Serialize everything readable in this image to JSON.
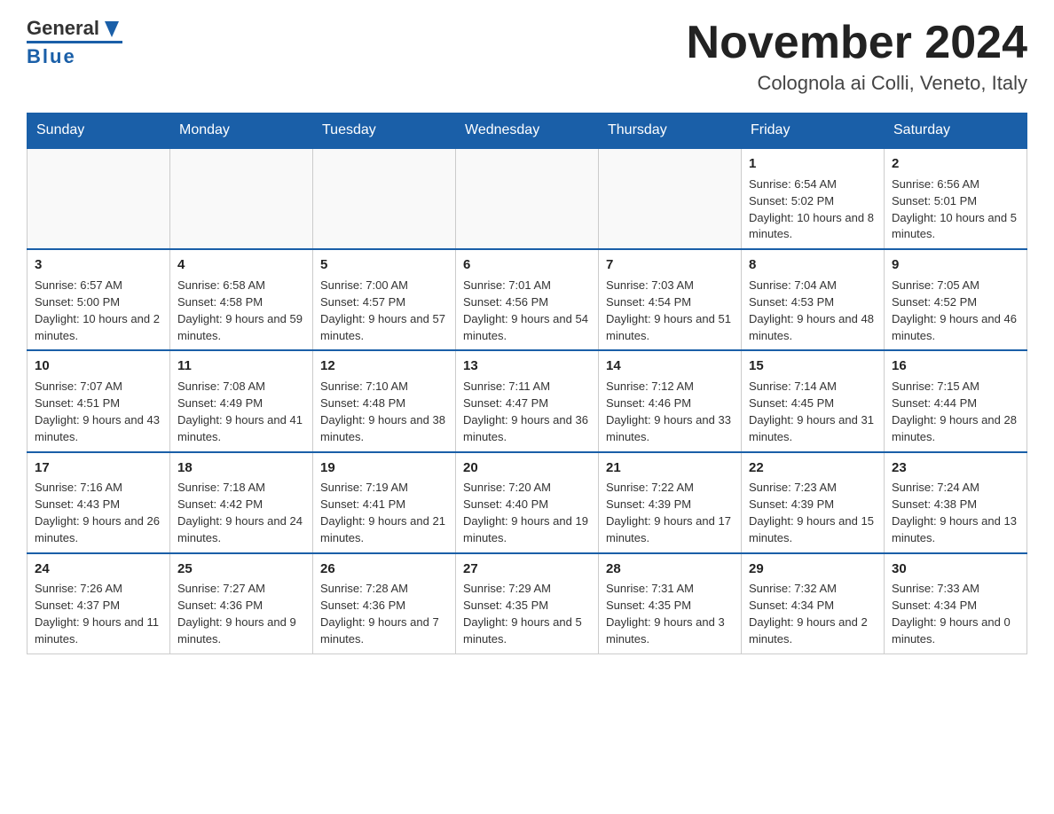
{
  "header": {
    "logo_general": "General",
    "logo_blue": "Blue",
    "month_title": "November 2024",
    "location": "Colognola ai Colli, Veneto, Italy"
  },
  "days_of_week": [
    "Sunday",
    "Monday",
    "Tuesday",
    "Wednesday",
    "Thursday",
    "Friday",
    "Saturday"
  ],
  "weeks": [
    [
      {
        "day": "",
        "info": ""
      },
      {
        "day": "",
        "info": ""
      },
      {
        "day": "",
        "info": ""
      },
      {
        "day": "",
        "info": ""
      },
      {
        "day": "",
        "info": ""
      },
      {
        "day": "1",
        "info": "Sunrise: 6:54 AM\nSunset: 5:02 PM\nDaylight: 10 hours and 8 minutes."
      },
      {
        "day": "2",
        "info": "Sunrise: 6:56 AM\nSunset: 5:01 PM\nDaylight: 10 hours and 5 minutes."
      }
    ],
    [
      {
        "day": "3",
        "info": "Sunrise: 6:57 AM\nSunset: 5:00 PM\nDaylight: 10 hours and 2 minutes."
      },
      {
        "day": "4",
        "info": "Sunrise: 6:58 AM\nSunset: 4:58 PM\nDaylight: 9 hours and 59 minutes."
      },
      {
        "day": "5",
        "info": "Sunrise: 7:00 AM\nSunset: 4:57 PM\nDaylight: 9 hours and 57 minutes."
      },
      {
        "day": "6",
        "info": "Sunrise: 7:01 AM\nSunset: 4:56 PM\nDaylight: 9 hours and 54 minutes."
      },
      {
        "day": "7",
        "info": "Sunrise: 7:03 AM\nSunset: 4:54 PM\nDaylight: 9 hours and 51 minutes."
      },
      {
        "day": "8",
        "info": "Sunrise: 7:04 AM\nSunset: 4:53 PM\nDaylight: 9 hours and 48 minutes."
      },
      {
        "day": "9",
        "info": "Sunrise: 7:05 AM\nSunset: 4:52 PM\nDaylight: 9 hours and 46 minutes."
      }
    ],
    [
      {
        "day": "10",
        "info": "Sunrise: 7:07 AM\nSunset: 4:51 PM\nDaylight: 9 hours and 43 minutes."
      },
      {
        "day": "11",
        "info": "Sunrise: 7:08 AM\nSunset: 4:49 PM\nDaylight: 9 hours and 41 minutes."
      },
      {
        "day": "12",
        "info": "Sunrise: 7:10 AM\nSunset: 4:48 PM\nDaylight: 9 hours and 38 minutes."
      },
      {
        "day": "13",
        "info": "Sunrise: 7:11 AM\nSunset: 4:47 PM\nDaylight: 9 hours and 36 minutes."
      },
      {
        "day": "14",
        "info": "Sunrise: 7:12 AM\nSunset: 4:46 PM\nDaylight: 9 hours and 33 minutes."
      },
      {
        "day": "15",
        "info": "Sunrise: 7:14 AM\nSunset: 4:45 PM\nDaylight: 9 hours and 31 minutes."
      },
      {
        "day": "16",
        "info": "Sunrise: 7:15 AM\nSunset: 4:44 PM\nDaylight: 9 hours and 28 minutes."
      }
    ],
    [
      {
        "day": "17",
        "info": "Sunrise: 7:16 AM\nSunset: 4:43 PM\nDaylight: 9 hours and 26 minutes."
      },
      {
        "day": "18",
        "info": "Sunrise: 7:18 AM\nSunset: 4:42 PM\nDaylight: 9 hours and 24 minutes."
      },
      {
        "day": "19",
        "info": "Sunrise: 7:19 AM\nSunset: 4:41 PM\nDaylight: 9 hours and 21 minutes."
      },
      {
        "day": "20",
        "info": "Sunrise: 7:20 AM\nSunset: 4:40 PM\nDaylight: 9 hours and 19 minutes."
      },
      {
        "day": "21",
        "info": "Sunrise: 7:22 AM\nSunset: 4:39 PM\nDaylight: 9 hours and 17 minutes."
      },
      {
        "day": "22",
        "info": "Sunrise: 7:23 AM\nSunset: 4:39 PM\nDaylight: 9 hours and 15 minutes."
      },
      {
        "day": "23",
        "info": "Sunrise: 7:24 AM\nSunset: 4:38 PM\nDaylight: 9 hours and 13 minutes."
      }
    ],
    [
      {
        "day": "24",
        "info": "Sunrise: 7:26 AM\nSunset: 4:37 PM\nDaylight: 9 hours and 11 minutes."
      },
      {
        "day": "25",
        "info": "Sunrise: 7:27 AM\nSunset: 4:36 PM\nDaylight: 9 hours and 9 minutes."
      },
      {
        "day": "26",
        "info": "Sunrise: 7:28 AM\nSunset: 4:36 PM\nDaylight: 9 hours and 7 minutes."
      },
      {
        "day": "27",
        "info": "Sunrise: 7:29 AM\nSunset: 4:35 PM\nDaylight: 9 hours and 5 minutes."
      },
      {
        "day": "28",
        "info": "Sunrise: 7:31 AM\nSunset: 4:35 PM\nDaylight: 9 hours and 3 minutes."
      },
      {
        "day": "29",
        "info": "Sunrise: 7:32 AM\nSunset: 4:34 PM\nDaylight: 9 hours and 2 minutes."
      },
      {
        "day": "30",
        "info": "Sunrise: 7:33 AM\nSunset: 4:34 PM\nDaylight: 9 hours and 0 minutes."
      }
    ]
  ]
}
